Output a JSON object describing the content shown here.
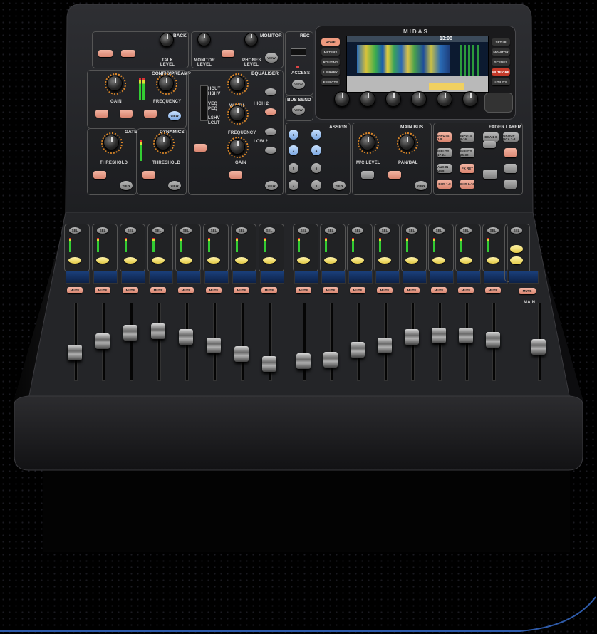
{
  "brand": "MIDAS",
  "sections": {
    "talkback": "BACK",
    "talkback_knob": "TALK LEVEL",
    "monitor": "MONITOR",
    "monitor_level": "MONITOR LEVEL",
    "phones_level": "PHONES LEVEL",
    "rec": "REC",
    "access": "ACCESS",
    "config": "CONFIG/PREAMP",
    "gain": "GAIN",
    "frequency": "FREQUENCY",
    "equaliser": "EQUALISER",
    "eq_width": "WIDTH",
    "eq_frequency": "FREQUENCY",
    "eq_gain": "GAIN",
    "high2": "HIGH 2",
    "low2": "LOW 2",
    "gate": "GATE",
    "threshold": "THRESHOLD",
    "dynamics": "DYNAMICS",
    "threshold2": "THRESHOLD",
    "bus_send": "BUS SEND",
    "assign": "ASSIGN",
    "main_bus": "MAIN BUS",
    "mc_level": "M/C LEVEL",
    "pan_bal": "PAN/BAL",
    "fader_layer": "FADER LAYER",
    "main": "MAIN"
  },
  "screen_buttons_left": [
    "HOME",
    "METERS",
    "ROUTING",
    "LIBRARY",
    "EFFECTS"
  ],
  "screen_buttons_right": [
    "SETUP",
    "MONITOR",
    "SCENES",
    "MUTE GRP",
    "UTILITY"
  ],
  "screen_time": "13:08",
  "eq_modes": [
    "HCUT",
    "HSHV",
    "VEQ",
    "PEQ",
    "LSHV",
    "LCUT"
  ],
  "assign_buttons": [
    "1",
    "2",
    "3",
    "4",
    "5",
    "6",
    "7",
    "8"
  ],
  "fader_layer_buttons": [
    "INPUTS 1-8",
    "INPUTS 9-16",
    "INPUTS 17-24",
    "INPUTS 25-32",
    "AUX IN USB",
    "FX RET",
    "BUS 1-8",
    "BUS 9-16",
    "DCA 1-8",
    "GROUP DCA 1-8"
  ],
  "mute_label": "MUTE",
  "sel_label": "SEL",
  "view_label": "VIEW",
  "colors": {
    "accent_salmon": "#e59a85",
    "accent_yellow": "#f1dc6a",
    "accent_blue": "#8fb8ef",
    "meter_orange": "#e08a2a",
    "lcd_blue": "#2a7bd0"
  },
  "fader_levels_left": [
    0.35,
    0.55,
    0.7,
    0.72,
    0.62,
    0.48,
    0.32,
    0.15
  ],
  "fader_levels_right": [
    0.2,
    0.22,
    0.4,
    0.48,
    0.62,
    0.65,
    0.65,
    0.58
  ],
  "fader_level_main": 0.45
}
